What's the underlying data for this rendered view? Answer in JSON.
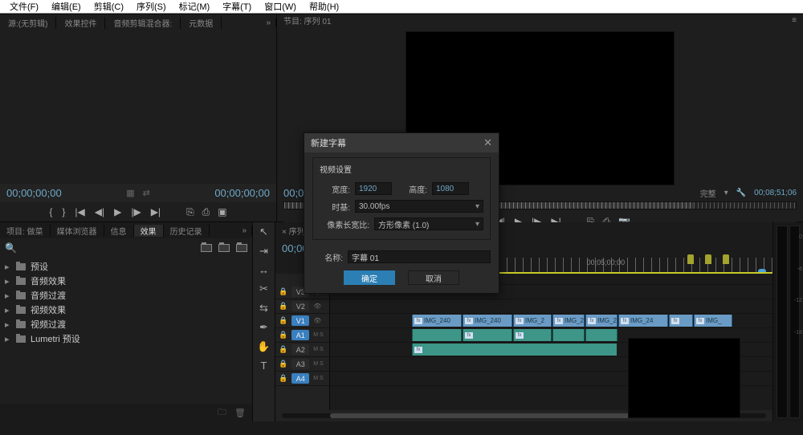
{
  "menu": {
    "file": "文件(F)",
    "edit": "编辑(E)",
    "clip": "剪辑(C)",
    "sequence": "序列(S)",
    "marker": "标记(M)",
    "subtitle": "字幕(T)",
    "window": "窗口(W)",
    "help": "帮助(H)"
  },
  "source": {
    "tabs": [
      "源:(无剪辑)",
      "效果控件",
      "音频剪辑混合器:",
      "元数据"
    ],
    "tc_left": "00;00;00;00",
    "tc_right": "00;00;00;00"
  },
  "program": {
    "hdr": "节目: 序列 01",
    "tc_left": "00;05",
    "fit": "完整",
    "tc_right": "00;08;51;06"
  },
  "project": {
    "tabs": [
      "项目: 做菜",
      "媒体浏览器",
      "信息",
      "效果",
      "历史记录"
    ],
    "tree": [
      "预设",
      "音频效果",
      "音频过渡",
      "视频效果",
      "视频过渡",
      "Lumetri 预设"
    ]
  },
  "timeline": {
    "hdr": "× 序列",
    "tc": "00;00",
    "ruler_label": "00;05;00;00",
    "tracks": {
      "v3": "V3",
      "v2": "V2",
      "v1": "V1",
      "a1": "A1",
      "a2": "A2",
      "a3": "A3",
      "a4": "A4"
    },
    "ms": "M  S",
    "clips": {
      "v1": [
        "IMG_240",
        "IMG_240",
        "IMG_2",
        "IMG_2",
        "IMG_2",
        "IMG_24",
        "IMG_"
      ]
    }
  },
  "meter_ticks": [
    "0",
    "-6",
    "-12",
    "-18"
  ],
  "dialog": {
    "title": "新建字幕",
    "group": "视频设置",
    "width_lbl": "宽度:",
    "width_val": "1920",
    "height_lbl": "高度:",
    "height_val": "1080",
    "fps_lbl": "时基:",
    "fps_val": "30.00fps",
    "par_lbl": "像素长宽比:",
    "par_val": "方形像素 (1.0)",
    "name_lbl": "名称:",
    "name_val": "字幕 01",
    "ok": "确定",
    "cancel": "取消"
  }
}
